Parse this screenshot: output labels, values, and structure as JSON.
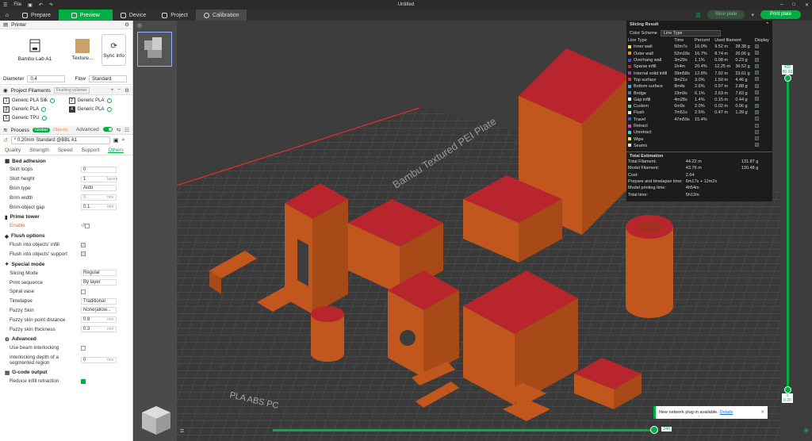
{
  "window": {
    "menu": "File",
    "title": "Untitled"
  },
  "tabs": [
    {
      "label": "Prepare"
    },
    {
      "label": "Preview"
    },
    {
      "label": "Device"
    },
    {
      "label": "Project"
    },
    {
      "label": "Calibration"
    }
  ],
  "actions": {
    "slice": "Slice plate",
    "print": "Print plate"
  },
  "printer": {
    "title": "Printer",
    "name": "Bambu Lab A1",
    "plate": "Texture...",
    "sync": "Sync info",
    "diameter_label": "Diameter",
    "diameter": "0.4",
    "flow_label": "Flow",
    "flow": "Standard"
  },
  "filaments": {
    "title": "Project Filaments",
    "flushing": "Flushing volumes",
    "items": [
      {
        "num": "1",
        "name": "Generic PLA Silk"
      },
      {
        "num": "2",
        "name": "Generic PLA"
      },
      {
        "num": "3",
        "name": "Generic PLA"
      },
      {
        "num": "4",
        "name": "Generic PLA"
      },
      {
        "num": "5",
        "name": "Generic TPU"
      }
    ]
  },
  "process": {
    "title": "Process",
    "global": "Global",
    "objects": "Objects",
    "advanced": "Advanced",
    "preset": "* 0.20mm Standard @BBL A1",
    "subtabs": [
      "Quality",
      "Strength",
      "Speed",
      "Support",
      "Others"
    ]
  },
  "groups": {
    "bed_adhesion": {
      "title": "Bed adhesion",
      "skirt_loops": {
        "label": "Skirt loops",
        "value": "0"
      },
      "skirt_height": {
        "label": "Skirt height",
        "value": "1",
        "unit": "layers"
      },
      "brim_type": {
        "label": "Brim type",
        "value": "Auto"
      },
      "brim_width": {
        "label": "Brim width",
        "value": "5",
        "unit": "mm"
      },
      "brim_gap": {
        "label": "Brim-object gap",
        "value": "0.1",
        "unit": "mm"
      }
    },
    "prime_tower": {
      "title": "Prime tower",
      "enable": "Enable"
    },
    "flush": {
      "title": "Flush options",
      "infill": "Flush into objects' infill",
      "support": "Flush into objects' support"
    },
    "special": {
      "title": "Special mode",
      "slicing_mode": {
        "label": "Slicing Mode",
        "value": "Regular"
      },
      "print_sequence": {
        "label": "Print sequence",
        "value": "By layer"
      },
      "spiral_vase": {
        "label": "Spiral vase"
      },
      "timelapse": {
        "label": "Timelapse",
        "value": "Traditional"
      },
      "fuzzy_skin": {
        "label": "Fuzzy Skin",
        "value": "None(allow..."
      },
      "fuzzy_dist": {
        "label": "Fuzzy skin point distance",
        "value": "0.8",
        "unit": "mm"
      },
      "fuzzy_thick": {
        "label": "Fuzzy skin thickness",
        "value": "0.3",
        "unit": "mm"
      }
    },
    "advanced": {
      "title": "Advanced",
      "beam": {
        "label": "Use beam interlocking"
      },
      "depth": {
        "label": "Interlocking depth of a segmented region",
        "value": "0",
        "unit": "mm"
      }
    },
    "gcode": {
      "title": "G-code output",
      "reduce": "Reduce infill retraction"
    }
  },
  "slicing_result": {
    "title": "Slicing Result",
    "scheme_label": "Color Scheme",
    "scheme": "Line Type",
    "headers": [
      "Line Type",
      "Time",
      "Percent",
      "Used filament",
      "Display"
    ],
    "rows": [
      {
        "type": "Inner wall",
        "time": "50m7s",
        "pct": "16.0%",
        "len": "9.52 m",
        "g": "28.38 g",
        "color": "#f1e04a",
        "on": true
      },
      {
        "type": "Outer wall",
        "time": "52m18s",
        "pct": "16.7%",
        "len": "8.74 m",
        "g": "26.06 g",
        "color": "#f08c2a",
        "on": true
      },
      {
        "type": "Overhang wall",
        "time": "3m29s",
        "pct": "1.1%",
        "len": "0.08 m",
        "g": "0.23 g",
        "color": "#4050e0",
        "on": true
      },
      {
        "type": "Sparse infill",
        "time": "1h4m",
        "pct": "20.4%",
        "len": "12.25 m",
        "g": "36.52 g",
        "color": "#b03030",
        "on": true
      },
      {
        "type": "Internal solid infill",
        "time": "39m58s",
        "pct": "12.8%",
        "len": "7.92 m",
        "g": "23.61 g",
        "color": "#9c3cb0",
        "on": true
      },
      {
        "type": "Top surface",
        "time": "9m21s",
        "pct": "3.0%",
        "len": "1.50 m",
        "g": "4.46 g",
        "color": "#e03030",
        "on": true
      },
      {
        "type": "Bottom surface",
        "time": "8m4s",
        "pct": "2.6%",
        "len": "0.97 m",
        "g": "2.88 g",
        "color": "#4aa0d8",
        "on": true
      },
      {
        "type": "Bridge",
        "time": "19m9s",
        "pct": "6.1%",
        "len": "2.63 m",
        "g": "7.83 g",
        "color": "#4a7fb0",
        "on": true
      },
      {
        "type": "Gap infill",
        "time": "4m28s",
        "pct": "1.4%",
        "len": "0.15 m",
        "g": "0.44 g",
        "color": "#ffffff",
        "on": true
      },
      {
        "type": "Custom",
        "time": "6m9s",
        "pct": "2.0%",
        "len": "0.02 m",
        "g": "0.06 g",
        "color": "#5fcf7f",
        "on": true
      },
      {
        "type": "Flush",
        "time": "7m51s",
        "pct": "2.5%",
        "len": "0.47 m",
        "g": "1.39 g",
        "color": "#e6e6e6",
        "on": true
      },
      {
        "type": "Travel",
        "time": "47m59s",
        "pct": "15.4%",
        "len": "",
        "g": "",
        "color": "#3a5ad8",
        "on": false
      },
      {
        "type": "Retract",
        "time": "",
        "pct": "",
        "len": "",
        "g": "",
        "color": "#d040d0",
        "on": false
      },
      {
        "type": "Unretract",
        "time": "",
        "pct": "",
        "len": "",
        "g": "",
        "color": "#40d0d0",
        "on": false
      },
      {
        "type": "Wipe",
        "time": "",
        "pct": "",
        "len": "",
        "g": "",
        "color": "#f0e040",
        "on": false
      },
      {
        "type": "Seams",
        "time": "",
        "pct": "",
        "len": "",
        "g": "",
        "color": "#e0e0e0",
        "on": true
      }
    ],
    "total_title": "Total Estimation",
    "totals": [
      {
        "label": "Total Filament:",
        "a": "44.22 m",
        "b": "131.87 g"
      },
      {
        "label": "Model Filament:",
        "a": "43.76 m",
        "b": "130.48 g"
      },
      {
        "label": "Cost:",
        "a": "2.64",
        "b": ""
      },
      {
        "label": "Prepare and timelapse time:",
        "a": "6m17s + 12m2s",
        "b": ""
      },
      {
        "label": "Model printing time:",
        "a": "4h54m",
        "b": ""
      },
      {
        "label": "Total time:",
        "a": "5h12m",
        "b": ""
      }
    ]
  },
  "sliders": {
    "top_layer": "400",
    "top_height": "80.00",
    "bottom_layer": "1",
    "bottom_height": "0.20",
    "move": "240"
  },
  "plate_text": "Bambu Textured PEI Plate",
  "plate_text2": "PLA ABS PC",
  "toast": {
    "text": "New network plug-in available.",
    "link": "Details"
  },
  "colors": {
    "accent": "#00ae42",
    "model": "#c2571d",
    "top": "#b8252c"
  }
}
